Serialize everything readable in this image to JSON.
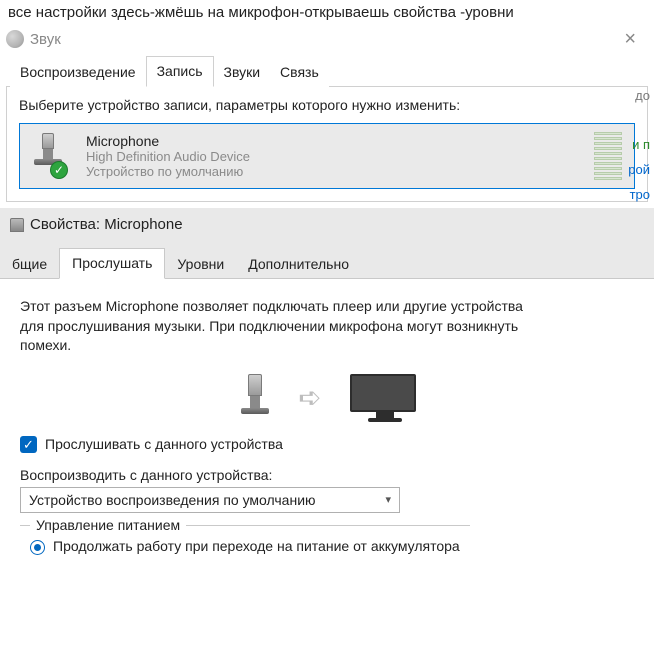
{
  "instruction": "все настройки здесь-жмёшь на микрофон-открываешь свойства -уровни",
  "sound_window": {
    "title": "Звук",
    "tabs": [
      "Воспроизведение",
      "Запись",
      "Звуки",
      "Связь"
    ],
    "active_tab_index": 1,
    "panel_hint": "Выберите устройство записи, параметры которого нужно изменить:",
    "device": {
      "name": "Microphone",
      "subtitle": "High Definition Audio Device",
      "default_label": "Устройство по умолчанию"
    }
  },
  "side_fragments": {
    "a": "до",
    "b": "и п",
    "c": "рой",
    "d": "тро"
  },
  "props_window": {
    "title": "Свойства: Microphone",
    "tabs": [
      "бщие",
      "Прослушать",
      "Уровни",
      "Дополнительно"
    ],
    "active_tab_index": 1,
    "paragraph": "Этот разъем Microphone позволяет подключать плеер или другие устройства для прослушивания музыки. При подключении микрофона могут возникнуть помехи.",
    "listen_checkbox_label": "Прослушивать с данного устройства",
    "listen_checked": true,
    "play_through_label": "Воспроизводить с данного устройства:",
    "play_through_value": "Устройство воспроизведения по умолчанию",
    "power_group_label": "Управление питанием",
    "power_radio_label": "Продолжать работу при переходе на питание от аккумулятора"
  }
}
